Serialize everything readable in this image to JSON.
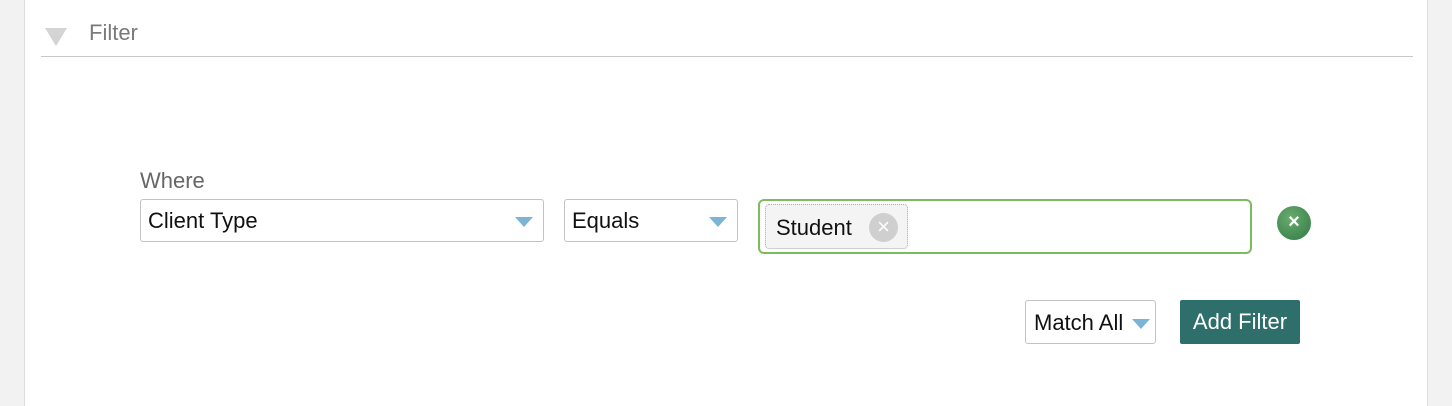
{
  "filter": {
    "title": "Filter",
    "where_label": "Where",
    "field": {
      "selected": "Client Type"
    },
    "operator": {
      "selected": "Equals"
    },
    "values": [
      {
        "label": "Student",
        "remove_icon": "close-icon"
      }
    ],
    "remove_row_icon": "circle-close-icon",
    "match": {
      "selected": "Match All"
    },
    "add_filter_label": "Add Filter"
  },
  "colors": {
    "accent_button": "#2f6f6b",
    "value_border": "#7dbb5f",
    "caret": "#7cb4d6",
    "remove_icon": "#2f7a43"
  }
}
